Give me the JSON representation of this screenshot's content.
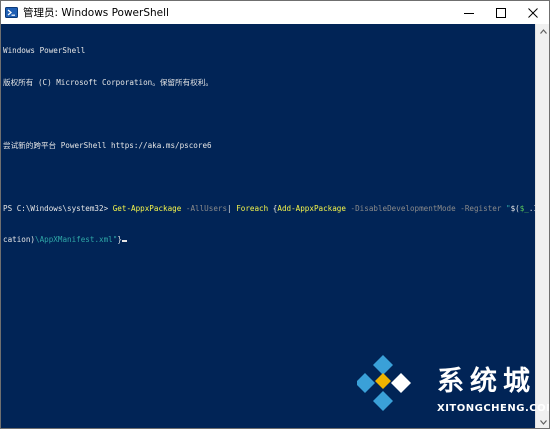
{
  "window": {
    "title": "管理员: Windows PowerShell",
    "icon": "powershell-icon",
    "caption_buttons": [
      "minimize-icon",
      "maximize-icon",
      "close-icon"
    ]
  },
  "console": {
    "lines": [
      "Windows PowerShell",
      "版权所有 (C) Microsoft Corporation。保留所有权利。",
      "",
      "尝试新的跨平台 PowerShell https://aka.ms/pscore6",
      ""
    ],
    "prompt": "PS C:\\Windows\\system32> ",
    "command_tokens": [
      {
        "text": "Get-AppxPackage",
        "kind": "cmd"
      },
      {
        "text": " ",
        "kind": "plain"
      },
      {
        "text": "-AllUsers",
        "kind": "param"
      },
      {
        "text": "| ",
        "kind": "plain"
      },
      {
        "text": "Foreach",
        "kind": "cmd"
      },
      {
        "text": " {",
        "kind": "plain"
      },
      {
        "text": "Add-AppxPackage",
        "kind": "cmd"
      },
      {
        "text": " ",
        "kind": "plain"
      },
      {
        "text": "-DisableDevelopmentMode",
        "kind": "param"
      },
      {
        "text": " ",
        "kind": "plain"
      },
      {
        "text": "-Register",
        "kind": "param"
      },
      {
        "text": " ",
        "kind": "plain"
      },
      {
        "text": "\"",
        "kind": "str"
      },
      {
        "text": "$(",
        "kind": "plain"
      },
      {
        "text": "$_",
        "kind": "var"
      },
      {
        "text": ".InstallLo",
        "kind": "plain"
      }
    ],
    "continuation_tokens": [
      {
        "text": "cation)",
        "kind": "plain"
      },
      {
        "text": "\\AppXManifest.xml\"",
        "kind": "str"
      },
      {
        "text": "}",
        "kind": "plain"
      }
    ],
    "colors": {
      "background": "#012456",
      "text": "#e6e6e6",
      "cmd": "#f5f54a",
      "param": "#8a8a8a",
      "var": "#5ac85a",
      "str": "#2fa7a7"
    }
  },
  "watermark": {
    "logo": "xitongcheng-logo-icon",
    "cn_text": "系统城",
    "en_text": "XITONGCHENG.COM"
  }
}
